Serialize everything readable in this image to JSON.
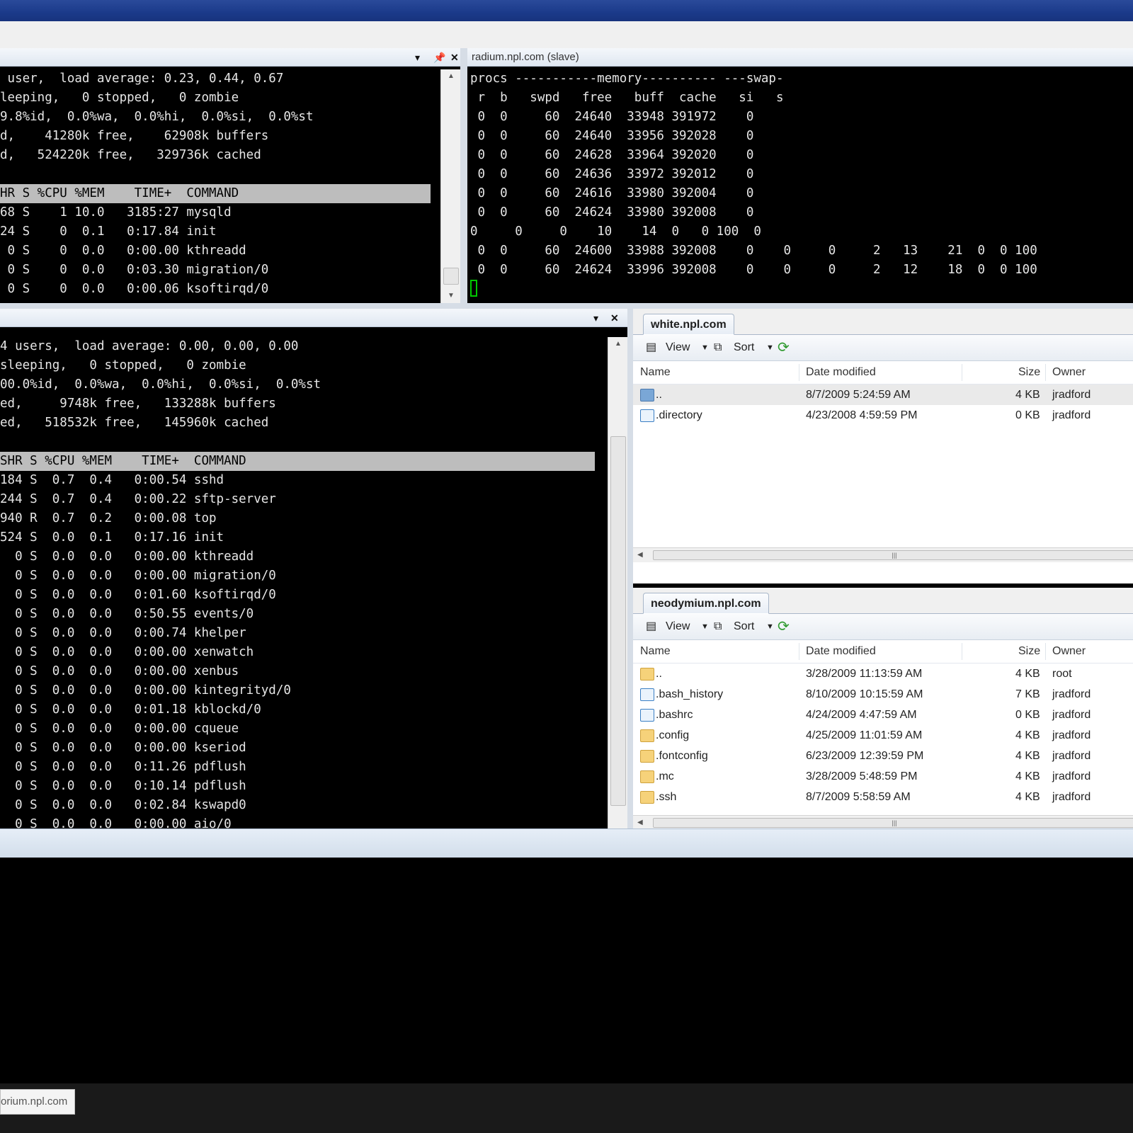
{
  "left_top_terminal": {
    "lines": [
      " user,  load average: 0.23, 0.44, 0.67",
      "leeping,   0 stopped,   0 zombie",
      "9.8%id,  0.0%wa,  0.0%hi,  0.0%si,  0.0%st",
      "d,    41280k free,    62908k buffers",
      "d,   524220k free,   329736k cached",
      "",
      "HR S %CPU %MEM    TIME+  COMMAND",
      "68 S    1 10.0   3185:27 mysqld",
      "24 S    0  0.1   0:17.84 init",
      " 0 S    0  0.0   0:00.00 kthreadd",
      " 0 S    0  0.0   0:03.30 migration/0",
      " 0 S    0  0.0   0:00.06 ksoftirqd/0"
    ]
  },
  "right_top_terminal": {
    "title": "radium.npl.com (slave)",
    "lines": [
      "procs -----------memory---------- ---swap-",
      " r  b   swpd   free   buff  cache   si   s",
      " 0  0     60  24640  33948 391972    0",
      " 0  0     60  24640  33956 392028    0",
      " 0  0     60  24628  33964 392020    0",
      " 0  0     60  24636  33972 392012    0",
      " 0  0     60  24616  33980 392004    0",
      " 0  0     60  24624  33980 392008    0",
      "0     0     0    10    14  0   0 100  0",
      " 0  0     60  24600  33988 392008    0    0     0     2   13    21  0  0 100",
      " 0  0     60  24624  33996 392008    0    0     0     2   12    18  0  0 100"
    ]
  },
  "left_bottom_terminal": {
    "lines": [
      "4 users,  load average: 0.00, 0.00, 0.00",
      "sleeping,   0 stopped,   0 zombie",
      "00.0%id,  0.0%wa,  0.0%hi,  0.0%si,  0.0%st",
      "ed,     9748k free,   133288k buffers",
      "ed,   518532k free,   145960k cached",
      "",
      "SHR S %CPU %MEM    TIME+  COMMAND",
      "184 S  0.7  0.4   0:00.54 sshd",
      "244 S  0.7  0.4   0:00.22 sftp-server",
      "940 R  0.7  0.2   0:00.08 top",
      "524 S  0.0  0.1   0:17.16 init",
      "  0 S  0.0  0.0   0:00.00 kthreadd",
      "  0 S  0.0  0.0   0:00.00 migration/0",
      "  0 S  0.0  0.0   0:01.60 ksoftirqd/0",
      "  0 S  0.0  0.0   0:50.55 events/0",
      "  0 S  0.0  0.0   0:00.74 khelper",
      "  0 S  0.0  0.0   0:00.00 xenwatch",
      "  0 S  0.0  0.0   0:00.00 xenbus",
      "  0 S  0.0  0.0   0:00.00 kintegrityd/0",
      "  0 S  0.0  0.0   0:01.18 kblockd/0",
      "  0 S  0.0  0.0   0:00.00 cqueue",
      "  0 S  0.0  0.0   0:00.00 kseriod",
      "  0 S  0.0  0.0   0:11.26 pdflush",
      "  0 S  0.0  0.0   0:10.14 pdflush",
      "  0 S  0.0  0.0   0:02.84 kswapd0",
      "  0 S  0.0  0.0   0:00.00 aio/0"
    ]
  },
  "file_panes": {
    "toolbar": {
      "view": "View",
      "sort": "Sort"
    },
    "columns": {
      "name": "Name",
      "date": "Date modified",
      "size": "Size",
      "owner": "Owner"
    },
    "white": {
      "tab": "white.npl.com",
      "rows": [
        {
          "icon": "up-image-icon",
          "name": "..",
          "date": "8/7/2009 5:24:59 AM",
          "size": "4 KB",
          "owner": "jradford"
        },
        {
          "icon": "document-icon",
          "name": ".directory",
          "date": "4/23/2008 4:59:59 PM",
          "size": "0 KB",
          "owner": "jradford"
        }
      ]
    },
    "neodymium": {
      "tab": "neodymium.npl.com",
      "rows": [
        {
          "icon": "folder-icon",
          "name": "..",
          "date": "3/28/2009 11:13:59 AM",
          "size": "4 KB",
          "owner": "root"
        },
        {
          "icon": "document-icon",
          "name": ".bash_history",
          "date": "8/10/2009 10:15:59 AM",
          "size": "7 KB",
          "owner": "jradford"
        },
        {
          "icon": "document-icon",
          "name": ".bashrc",
          "date": "4/24/2009 4:47:59 AM",
          "size": "0 KB",
          "owner": "jradford"
        },
        {
          "icon": "folder-icon",
          "name": ".config",
          "date": "4/25/2009 11:01:59 AM",
          "size": "4 KB",
          "owner": "jradford"
        },
        {
          "icon": "folder-icon",
          "name": ".fontconfig",
          "date": "6/23/2009 12:39:59 PM",
          "size": "4 KB",
          "owner": "jradford"
        },
        {
          "icon": "folder-icon",
          "name": ".mc",
          "date": "3/28/2009 5:48:59 PM",
          "size": "4 KB",
          "owner": "jradford"
        },
        {
          "icon": "folder-icon",
          "name": ".ssh",
          "date": "8/7/2009 5:58:59 AM",
          "size": "4 KB",
          "owner": "jradford"
        }
      ]
    }
  },
  "bottom_tab": {
    "label": "orium.npl.com"
  },
  "colors": {
    "title_blue": "#1b3a8a",
    "cursor_green": "#00c800",
    "terminal_bg": "#000000",
    "header_highlight": "#bdbdbd"
  }
}
